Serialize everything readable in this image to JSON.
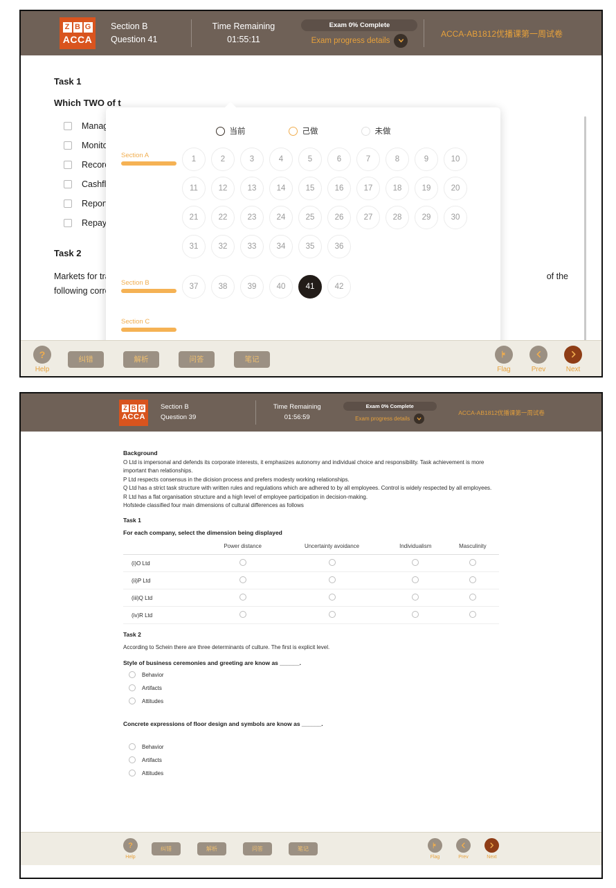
{
  "panel_one": {
    "header": {
      "logo": {
        "cells": [
          "Z",
          "B",
          "G"
        ],
        "word": "ACCA"
      },
      "section_label": "Section B",
      "question_label": "Question 41",
      "time_title": "Time Remaining",
      "time_value": "01:55:11",
      "progress_pill": "Exam 0% Complete",
      "progress_details": "Exam progress details",
      "chevron_icon": "chevron-down-icon",
      "exam_title": "ACCA-AB1812优播课第一周试卷"
    },
    "content": {
      "task1_label": "Task 1",
      "task1_stem": "Which TWO of t",
      "options": [
        "Managing t",
        "Monitoring",
        "Recording f",
        "Cashflow fo",
        "Reporting t",
        "Repaying lo"
      ],
      "task2_label": "Task 2",
      "task2_para_start": "Markets for trad",
      "task2_para_end": "of the",
      "task2_para_line2": "following correctly fills the gap above?"
    },
    "popover": {
      "legend": [
        {
          "state": "current",
          "label": "当前"
        },
        {
          "state": "done",
          "label": "己做"
        },
        {
          "state": "undone",
          "label": "未做"
        }
      ],
      "sections": [
        {
          "name": "Section A",
          "questions": [
            "1",
            "2",
            "3",
            "4",
            "5",
            "6",
            "7",
            "8",
            "9",
            "10",
            "11",
            "12",
            "13",
            "14",
            "15",
            "16",
            "17",
            "18",
            "19",
            "20",
            "21",
            "22",
            "23",
            "24",
            "25",
            "26",
            "27",
            "28",
            "29",
            "30",
            "31",
            "32",
            "33",
            "34",
            "35",
            "36"
          ],
          "current": null
        },
        {
          "name": "Section B",
          "questions": [
            "37",
            "38",
            "39",
            "40",
            "41",
            "42"
          ],
          "current": "41"
        },
        {
          "name": "Section C",
          "questions": [],
          "current": null
        }
      ]
    },
    "toolbar": {
      "help_icon": "question-mark-icon",
      "help_caption": "Help",
      "pills": [
        "纠错",
        "解析",
        "问答",
        "笔记"
      ],
      "flag_icon": "flag-icon",
      "flag_caption": "Flag",
      "prev_icon": "chevron-left-icon",
      "prev_caption": "Prev",
      "next_icon": "chevron-right-icon",
      "next_caption": "Next"
    }
  },
  "panel_two": {
    "header": {
      "logo": {
        "cells": [
          "Z",
          "B",
          "G"
        ],
        "word": "ACCA"
      },
      "section_label": "Section B",
      "question_label": "Question 39",
      "time_title": "Time Remaining",
      "time_value": "01:56:59",
      "progress_pill": "Exam 0% Complete",
      "progress_details": "Exam progress details",
      "chevron_icon": "chevron-down-icon",
      "exam_title": "ACCA-AB1812优播课第一周试卷"
    },
    "content": {
      "background_heading": "Background",
      "background_paras": [
        "O Ltd is impersonal and defends its corporate interests, it emphasizes autonomy and individual choice and responsibility. Task achievement is more important than relationships.",
        "P Ltd respects consensus in the dicision process and prefers modesty working relationships.",
        "Q Ltd has a strict task structure with written rules and regulations which are adhered to by all employees. Control is widely respected by all employees.",
        "R Ltd has a flat organisation structure and a high level of employee participation in decision-making.",
        "Hofstede classified four main dimensions of cultural differences as follows"
      ],
      "task1_label": "Task 1",
      "task1_stem": "For each company, select the dimension being displayed",
      "table": {
        "columns": [
          "Power distance",
          "Uncertainty avoidance",
          "Individualism",
          "Masculinity"
        ],
        "rows": [
          "(i)O Ltd",
          "(ii)P Ltd",
          "(iii)Q Ltd",
          "(iv)R Ltd"
        ]
      },
      "task2_label": "Task 2",
      "task2_intro": "According to Schein there are three determinants of culture. The first is explicit level.",
      "task2_q1": "Style of business ceremonies and greeting are know as ______.",
      "task2_q1_options": [
        "Behavior",
        "Artifacts",
        "Attitudes"
      ],
      "task2_q2": "Concrete expressions of floor design and symbols are know as ______.",
      "task2_q2_options": [
        "Behavior",
        "Artifacts",
        "Attitudes"
      ]
    },
    "toolbar": {
      "help_icon": "question-mark-icon",
      "help_caption": "Help",
      "pills": [
        "纠错",
        "解析",
        "问答",
        "笔记"
      ],
      "flag_icon": "flag-icon",
      "flag_caption": "Flag",
      "prev_icon": "chevron-left-icon",
      "prev_caption": "Prev",
      "next_icon": "chevron-right-icon",
      "next_caption": "Next"
    }
  },
  "colors": {
    "header_bg": "#6f6157",
    "accent_orange": "#e7a13b",
    "logo_orange": "#d9541e",
    "toolbar_bg": "#efece3",
    "next_btn": "#8e3d16",
    "current_bubble": "#221c18",
    "section_bar": "#f5b254"
  }
}
